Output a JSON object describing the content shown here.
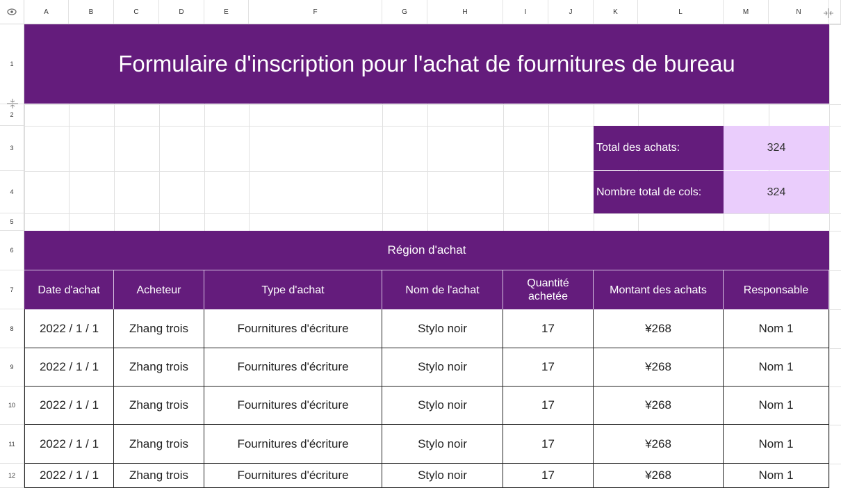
{
  "columns": [
    "A",
    "B",
    "C",
    "D",
    "E",
    "F",
    "G",
    "H",
    "I",
    "J",
    "K",
    "L",
    "M",
    "N"
  ],
  "rows": [
    "1",
    "2",
    "3",
    "4",
    "5",
    "6",
    "7",
    "8",
    "9",
    "10",
    "11",
    "12"
  ],
  "title": "Formulaire d'inscription pour l'achat de fournitures de bureau",
  "summary": {
    "total_purchases_label": "Total des achats:",
    "total_purchases_value": "324",
    "total_packages_label": "Nombre total de cols:",
    "total_packages_value": "324"
  },
  "region_header": "Région d'achat",
  "table": {
    "headers": [
      "Date d'achat",
      "Acheteur",
      "Type d'achat",
      "Nom de l'achat",
      "Quantité achetée",
      "Montant des achats",
      "Responsable"
    ],
    "rows": [
      [
        "2022 / 1 / 1",
        "Zhang trois",
        "Fournitures d'écriture",
        "Stylo noir",
        "17",
        "¥268",
        "Nom 1"
      ],
      [
        "2022 / 1 / 1",
        "Zhang trois",
        "Fournitures d'écriture",
        "Stylo noir",
        "17",
        "¥268",
        "Nom 1"
      ],
      [
        "2022 / 1 / 1",
        "Zhang trois",
        "Fournitures d'écriture",
        "Stylo noir",
        "17",
        "¥268",
        "Nom 1"
      ],
      [
        "2022 / 1 / 1",
        "Zhang trois",
        "Fournitures d'écriture",
        "Stylo noir",
        "17",
        "¥268",
        "Nom 1"
      ],
      [
        "2022 / 1 / 1",
        "Zhang trois",
        "Fournitures d'écriture",
        "Stylo noir",
        "17",
        "¥268",
        "Nom 1"
      ]
    ]
  },
  "icons": {
    "corner": "eye-icon",
    "freeze_col": "freeze-column-icon",
    "freeze_row": "freeze-row-icon"
  },
  "colors": {
    "accent": "#641c7c",
    "highlight": "#eacdfc"
  }
}
